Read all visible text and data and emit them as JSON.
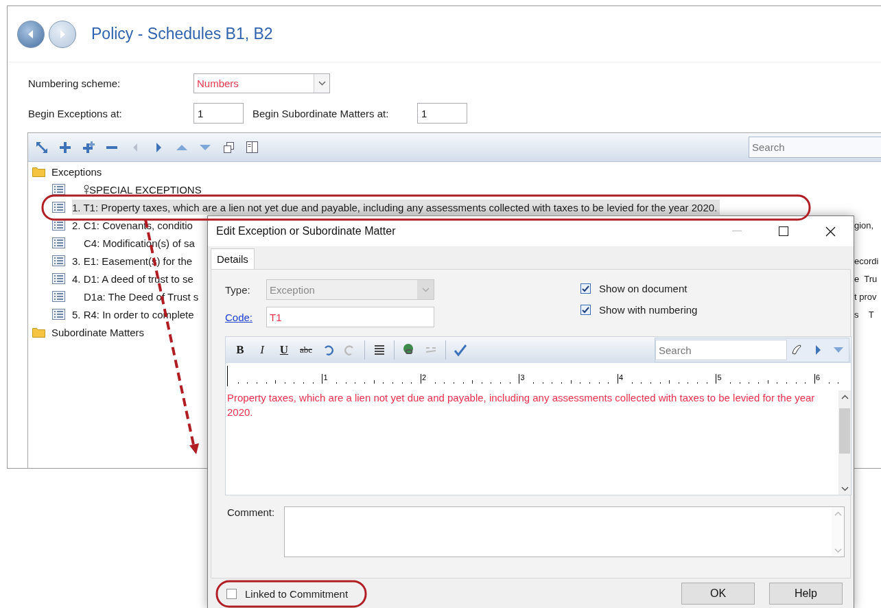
{
  "window": {
    "title": "Policy - Schedules B1, B2",
    "nav": [
      {
        "kind": "back",
        "disabled": false
      },
      {
        "kind": "forward",
        "disabled": true
      }
    ]
  },
  "form": {
    "numbering_scheme": {
      "label": "Numbering scheme:",
      "value": "Numbers"
    },
    "begin_exceptions": {
      "label": "Begin Exceptions at:",
      "value": "1"
    },
    "begin_subordinate": {
      "label": "Begin Subordinate Matters at:",
      "value": "1"
    }
  },
  "tree_toolbar": {
    "buttons": [
      {
        "kind": "refresh",
        "disabled": false
      },
      {
        "kind": "add",
        "disabled": false
      },
      {
        "kind": "add-child",
        "disabled": false
      },
      {
        "kind": "remove",
        "disabled": false
      },
      {
        "kind": "left",
        "disabled": true
      },
      {
        "kind": "right",
        "disabled": false
      },
      {
        "kind": "up",
        "disabled": false
      },
      {
        "kind": "down",
        "disabled": false
      },
      {
        "kind": "copy",
        "disabled": false
      },
      {
        "kind": "columns",
        "disabled": false
      }
    ],
    "search": {
      "placeholder": "Search"
    }
  },
  "tree": [
    {
      "label": "Exceptions",
      "children": [
        {
          "label": "SPECIAL EXCEPTIONS",
          "indented": true,
          "pin": true,
          "selected": false
        },
        {
          "label": "1. T1: Property taxes, which are a lien not yet due and payable, including any assessments collected with taxes to be levied for the year 2020.",
          "indented": false,
          "selected": true
        },
        {
          "label": "2. C1: Covenants, conditio",
          "tail": "gion,",
          "indented": false,
          "selected": false
        },
        {
          "label": "C4: Modification(s) of sa",
          "indented": true,
          "selected": false
        },
        {
          "label": "3. E1: Easement(s) for the",
          "tail": "ecordi",
          "indented": false,
          "selected": false
        },
        {
          "label": "4. D1: A deed of trust to se",
          "tail": "e  Tru",
          "indented": false,
          "selected": false
        },
        {
          "label": "D1a: The Deed of Trust s",
          "tail": "t prov",
          "indented": true,
          "selected": false
        },
        {
          "label": "5. R4: In order to complete",
          "tail": "s    T",
          "indented": false,
          "selected": false
        }
      ]
    },
    {
      "label": "Subordinate Matters"
    }
  ],
  "dialog": {
    "title": "Edit Exception or Subordinate Matter",
    "tabs": [
      {
        "label": "Details",
        "selected": true
      }
    ],
    "type": {
      "label": "Type:",
      "value": "Exception",
      "disabled": true
    },
    "code": {
      "label": "Code:",
      "value": "T1"
    },
    "checks": [
      {
        "label": "Show on document",
        "checked": true
      },
      {
        "label": "Show with numbering",
        "checked": true
      }
    ],
    "editor": {
      "format_buttons": [
        {
          "label": "B",
          "kind": "bold"
        },
        {
          "label": "I",
          "kind": "italic"
        },
        {
          "label": "U",
          "kind": "underline"
        },
        {
          "label": "abc",
          "kind": "strike"
        }
      ],
      "tools": [
        {
          "kind": "undo",
          "disabled": false
        },
        {
          "kind": "redo",
          "disabled": true
        },
        {
          "kind": "sep"
        },
        {
          "kind": "list",
          "disabled": false
        },
        {
          "kind": "sep"
        },
        {
          "kind": "link",
          "disabled": false
        },
        {
          "kind": "unlink",
          "disabled": true
        },
        {
          "kind": "sep"
        },
        {
          "kind": "spellcheck",
          "disabled": false
        }
      ],
      "search": {
        "placeholder": "Search"
      },
      "ruler": [
        "1",
        "2",
        "3",
        "4",
        "5",
        "6"
      ],
      "text": "Property taxes, which are a lien not yet due and payable, including any assessments collected with taxes to be levied for the year 2020."
    },
    "comment": {
      "label": "Comment:"
    },
    "linked": {
      "label": "Linked to Commitment",
      "checked": false
    },
    "buttons": [
      "OK",
      "Help"
    ]
  }
}
